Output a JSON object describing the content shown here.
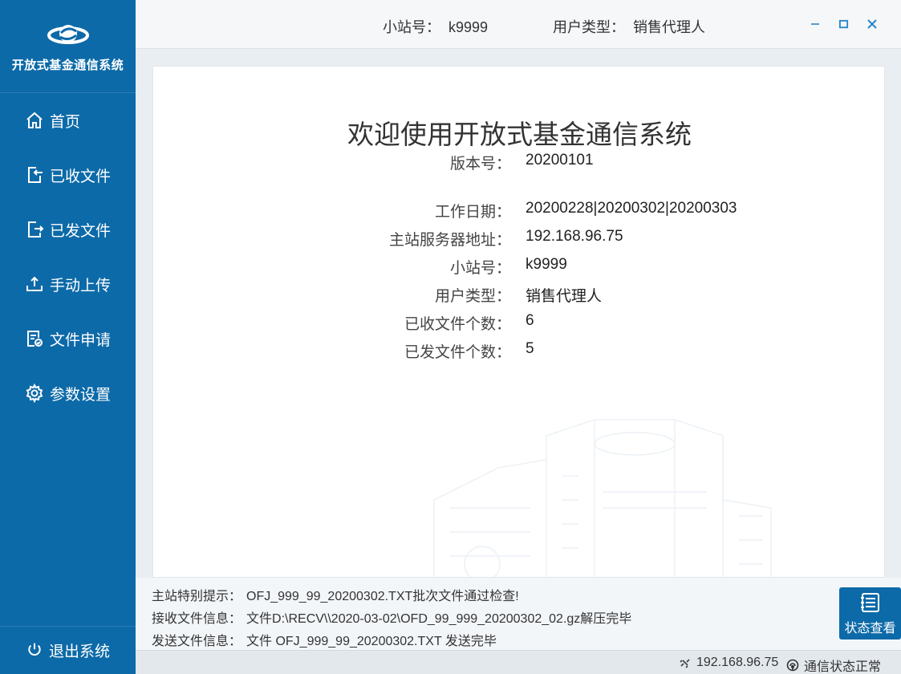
{
  "app": {
    "title": "开放式基金通信系统"
  },
  "sidebar": {
    "items": [
      {
        "label": "首页",
        "icon": "home-icon"
      },
      {
        "label": "已收文件",
        "icon": "received-file-icon"
      },
      {
        "label": "已发文件",
        "icon": "sent-file-icon"
      },
      {
        "label": "手动上传",
        "icon": "upload-icon"
      },
      {
        "label": "文件申请",
        "icon": "file-request-icon"
      },
      {
        "label": "参数设置",
        "icon": "gear-icon"
      }
    ],
    "logout_label": "退出系统"
  },
  "header": {
    "station_label": "小站号：",
    "station_value": "k9999",
    "user_type_label": "用户类型：",
    "user_type_value": "销售代理人"
  },
  "main": {
    "welcome": "欢迎使用开放式基金通信系统",
    "version_label": "版本号：",
    "version_value": "20200101",
    "work_date_label": "工作日期：",
    "work_date_value": "20200228|20200302|20200303",
    "server_label": "主站服务器地址：",
    "server_value": "192.168.96.75",
    "station_label": "小站号：",
    "station_value": "k9999",
    "user_type_label": "用户类型：",
    "user_type_value": "销售代理人",
    "received_count_label": "已收文件个数：",
    "received_count_value": "6",
    "sent_count_label": "已发文件个数：",
    "sent_count_value": "5"
  },
  "messages": {
    "notice_label": "主站特别提示：",
    "notice_value": "OFJ_999_99_20200302.TXT批次文件通过检查!",
    "recv_label": "接收文件信息：",
    "recv_value": "文件D:\\RECV\\\\2020-03-02\\OFD_99_999_20200302_02.gz解压完毕",
    "send_label": "发送文件信息：",
    "send_value": "文件 OFJ_999_99_20200302.TXT 发送完毕",
    "status_button_label": "状态查看"
  },
  "statusbar": {
    "ip": "192.168.96.75",
    "connection": "通信状态正常"
  },
  "colors": {
    "sidebar": "#0d6aa8",
    "accent": "#2a86c6"
  }
}
